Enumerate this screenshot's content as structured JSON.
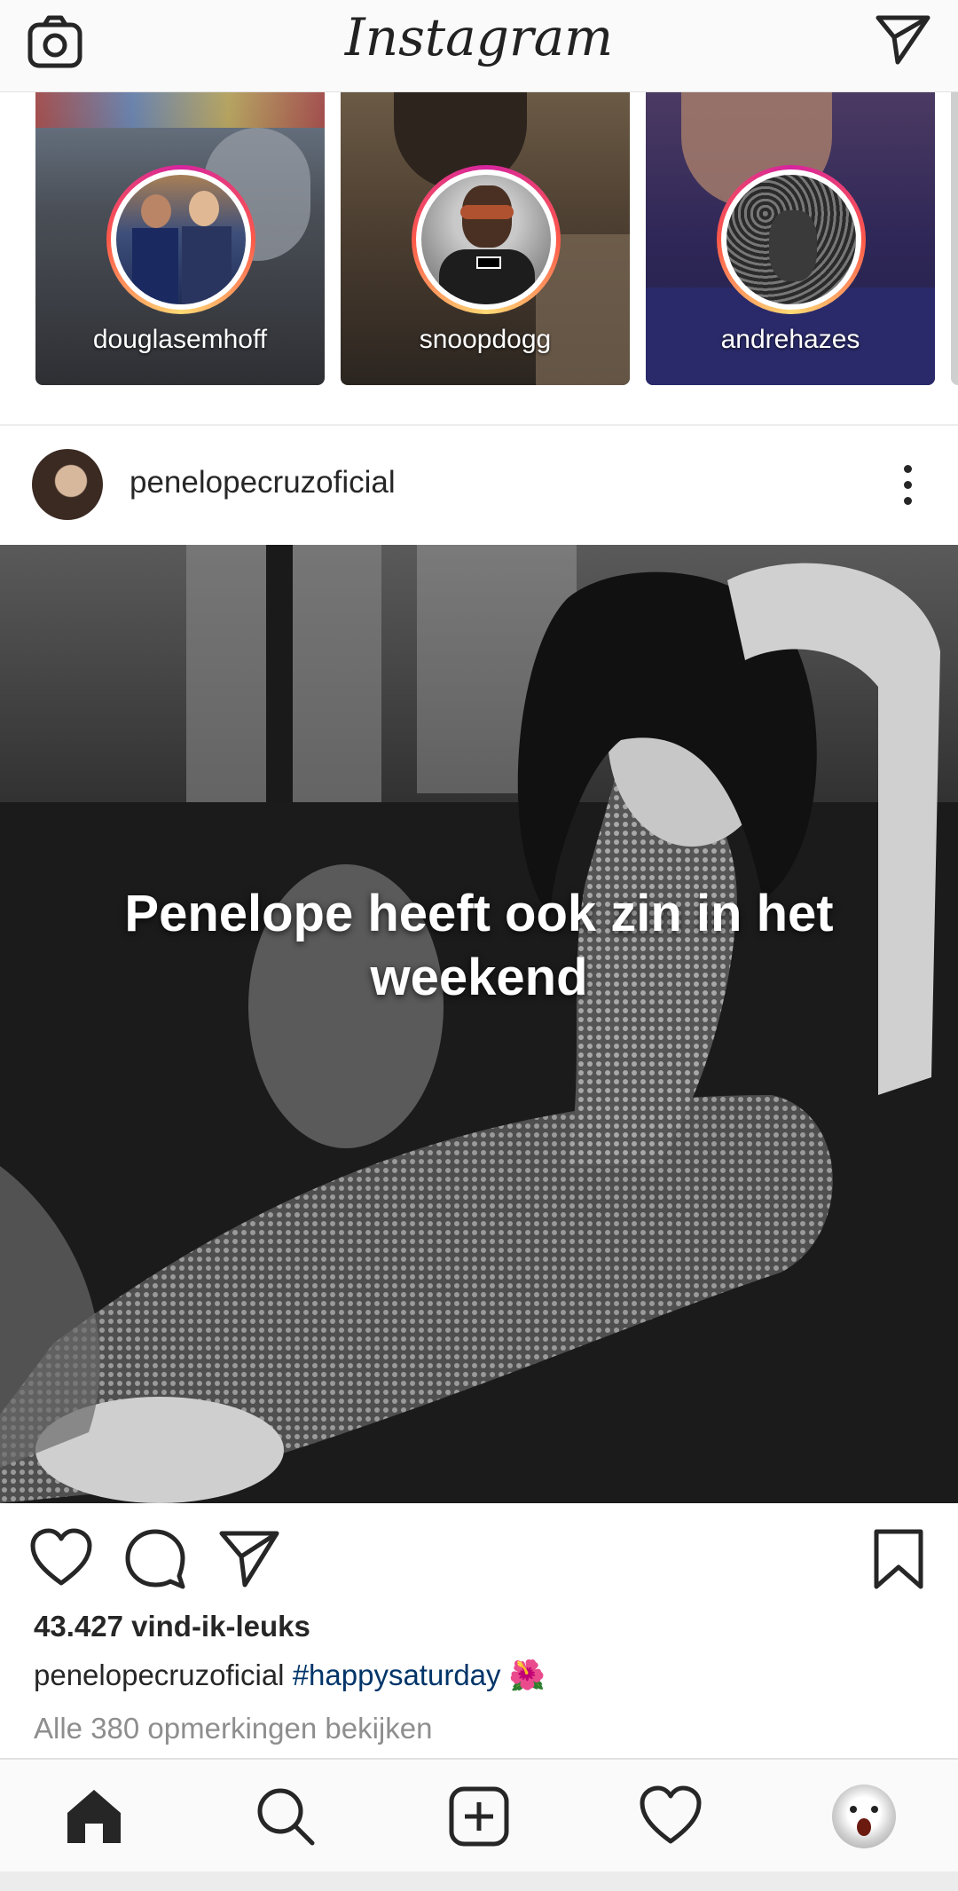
{
  "topbar": {
    "logo": "Instagram",
    "camera_icon": "camera-icon",
    "direct_icon": "paper-plane-icon"
  },
  "stories": [
    {
      "username": "douglasemhoff"
    },
    {
      "username": "snoopdogg"
    },
    {
      "username": "andrehazes"
    }
  ],
  "post": {
    "username": "penelopecruzoficial",
    "overlay_text": "Penelope heeft ook zin in het weekend",
    "likes": "43.427 vind-ik-leuks",
    "caption_user": "penelopecruzoficial",
    "caption_hashtag": "#happysaturday",
    "caption_emoji": "🌺",
    "view_comments": "Alle 380 opmerkingen bekijken"
  },
  "colors": {
    "hashtag": "#003569",
    "muted": "#8e8e8e",
    "text": "#262626"
  }
}
